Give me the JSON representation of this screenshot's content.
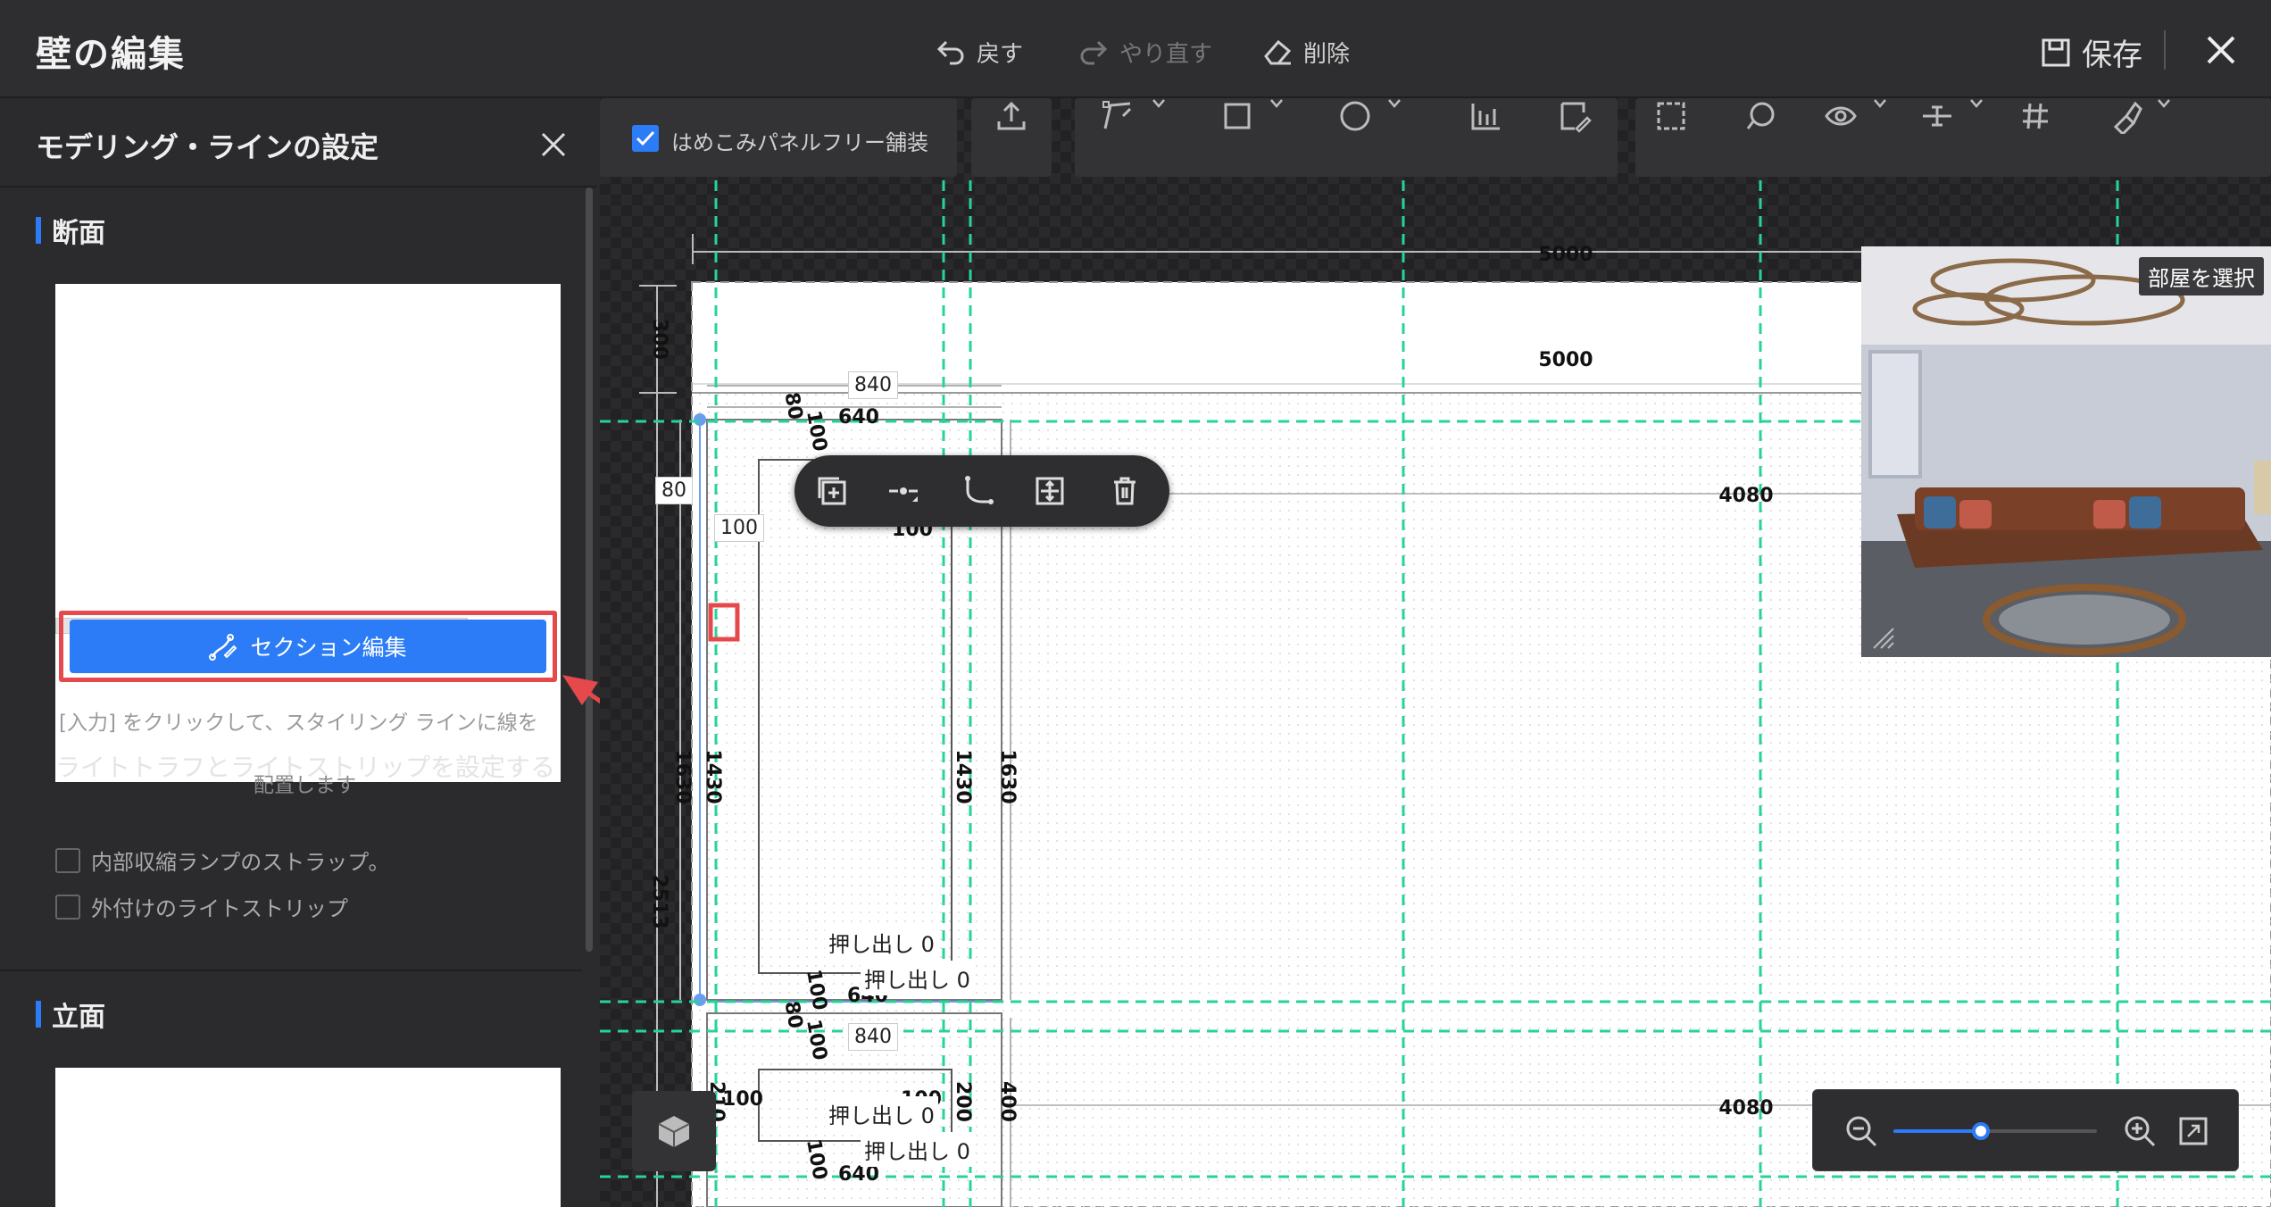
{
  "window": {
    "title": "壁の編集",
    "undo_label": "戻す",
    "redo_label": "やり直す",
    "delete_label": "削除",
    "save_label": "保存"
  },
  "left_panel": {
    "title": "モデリング・ラインの設定",
    "section_heading": "断面",
    "section_edit_button": "セクション編集",
    "hint_click": "[入力] をクリックして、スタイリング ラインに線を",
    "hint_place": "配置します",
    "hint_light": "ライトトラフとライトストリップを設定する",
    "checkbox_internal": "内部収縮ランプのストラップ。",
    "checkbox_external": "外付けのライトストリップ",
    "elevation_heading": "立面"
  },
  "toolbar": {
    "panel_free_label": "はめこみパネルフリー舗装",
    "panel_free_checked": true
  },
  "canvas": {
    "room_select_label": "部屋を選択",
    "dimensions": {
      "top_total": "5000",
      "inner_total": "5000",
      "height_top": "300",
      "height_total": "2513",
      "right_span_1": "4080",
      "right_span_2": "4080",
      "panel_width_outer": "840",
      "panel_width_inner": "640",
      "panel_border_a": "80",
      "panel_border_b": "100",
      "panel_height_outer": "1630",
      "panel_height_inner": "1430",
      "panel2_width_outer": "840",
      "panel2_width_inner": "640",
      "small_210": "210",
      "small_200": "200",
      "small_400": "400"
    },
    "extrude_label": "押し出し",
    "extrude_value": "0"
  },
  "zoom": {
    "level": 0.43
  },
  "colors": {
    "accent_blue": "#2b7cf6",
    "guide_green": "#27d39b",
    "highlight_red": "#e6494b"
  }
}
